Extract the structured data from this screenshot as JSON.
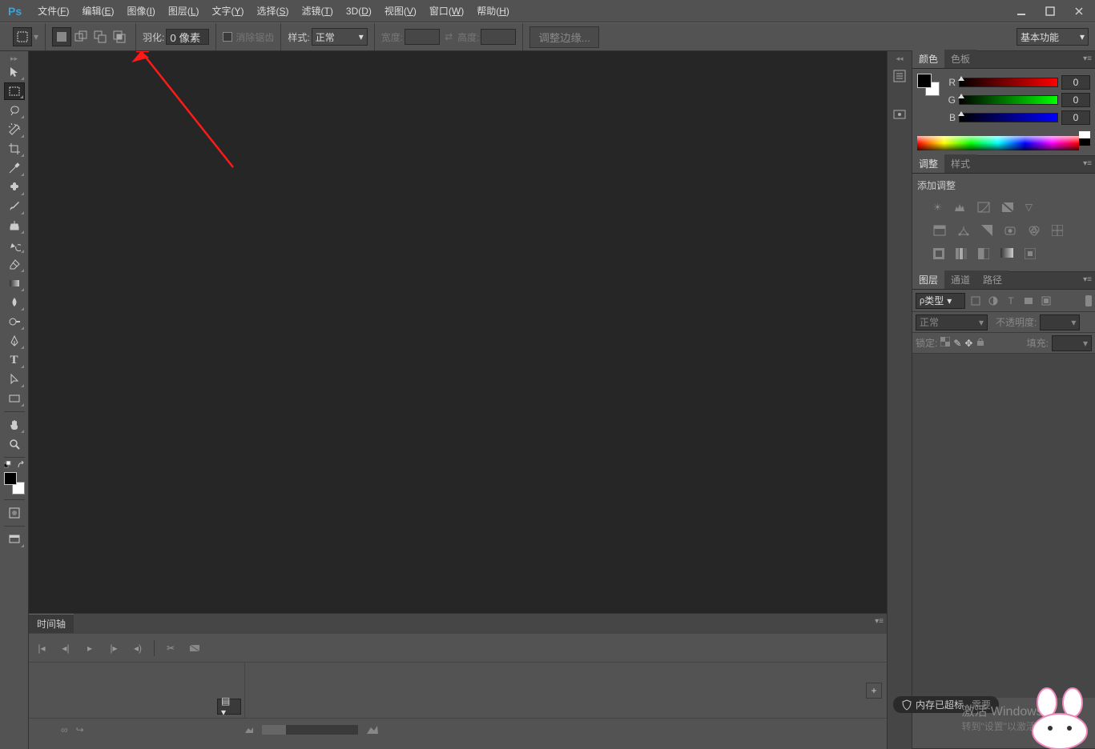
{
  "menubar": {
    "logo": "Ps",
    "items": [
      {
        "label": "文件(F)",
        "u": "F"
      },
      {
        "label": "编辑(E)",
        "u": "E"
      },
      {
        "label": "图像(I)",
        "u": "I"
      },
      {
        "label": "图层(L)",
        "u": "L"
      },
      {
        "label": "文字(Y)",
        "u": "Y"
      },
      {
        "label": "选择(S)",
        "u": "S"
      },
      {
        "label": "滤镜(T)",
        "u": "T"
      },
      {
        "label": "3D(D)",
        "u": "D"
      },
      {
        "label": "视图(V)",
        "u": "V"
      },
      {
        "label": "窗口(W)",
        "u": "W"
      },
      {
        "label": "帮助(H)",
        "u": "H"
      }
    ]
  },
  "optionsbar": {
    "feather_label": "羽化:",
    "feather_value": "0 像素",
    "antialias_label": "消除锯齿",
    "style_label": "样式:",
    "style_value": "正常",
    "width_label": "宽度:",
    "height_label": "高度:",
    "refine_label": "调整边缘...",
    "workspace": "基本功能"
  },
  "timeline": {
    "tab": "时间轴"
  },
  "panels": {
    "color": {
      "tab1": "颜色",
      "tab2": "色板",
      "r": "R",
      "g": "G",
      "b": "B",
      "rv": "0",
      "gv": "0",
      "bv": "0"
    },
    "adjust": {
      "tab1": "调整",
      "tab2": "样式",
      "title": "添加调整"
    },
    "layers": {
      "tab1": "图层",
      "tab2": "通道",
      "tab3": "路径",
      "kind_label": "类型",
      "blend": "正常",
      "opacity_label": "不透明度:",
      "lock_label": "锁定:",
      "fill_label": "填充:"
    }
  },
  "status": {
    "mem": "内存已超标",
    "need": "需要"
  },
  "watermark": {
    "line1": "激活 Windows",
    "line2": "转到\"设置\"以激活 Windows。"
  },
  "search_placeholder": "ρ"
}
